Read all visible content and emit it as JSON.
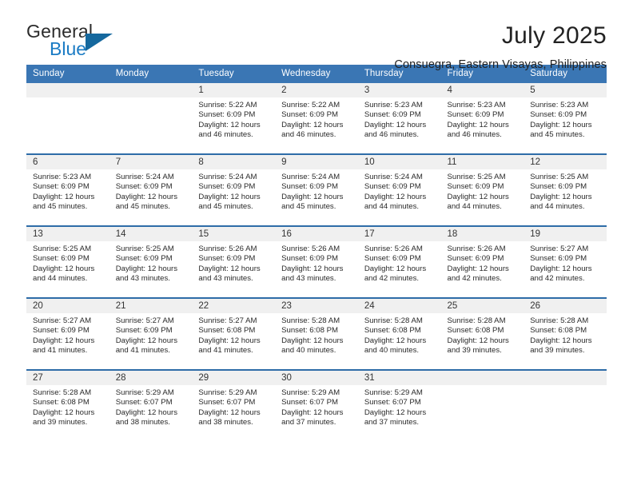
{
  "logo": {
    "text_top": "General",
    "text_bottom": "Blue",
    "triangle_color": "#15689e",
    "blue_color": "#1a7bc4"
  },
  "header": {
    "title": "July 2025",
    "subtitle": "Consuegra, Eastern Visayas, Philippines"
  },
  "theme": {
    "header_blue": "#3a76b4",
    "row_divider_blue": "#2e6ca8",
    "daynum_gray": "#f0f0f0"
  },
  "weekdays": [
    "Sunday",
    "Monday",
    "Tuesday",
    "Wednesday",
    "Thursday",
    "Friday",
    "Saturday"
  ],
  "labels": {
    "sunrise_prefix": "Sunrise:",
    "sunset_prefix": "Sunset:",
    "daylight_prefix": "Daylight:"
  },
  "weeks": [
    [
      {
        "day": "",
        "empty": true
      },
      {
        "day": "",
        "empty": true
      },
      {
        "day": "1",
        "sunrise": "Sunrise: 5:22 AM",
        "sunset": "Sunset: 6:09 PM",
        "daylight_line1": "Daylight: 12 hours",
        "daylight_line2": "and 46 minutes."
      },
      {
        "day": "2",
        "sunrise": "Sunrise: 5:22 AM",
        "sunset": "Sunset: 6:09 PM",
        "daylight_line1": "Daylight: 12 hours",
        "daylight_line2": "and 46 minutes."
      },
      {
        "day": "3",
        "sunrise": "Sunrise: 5:23 AM",
        "sunset": "Sunset: 6:09 PM",
        "daylight_line1": "Daylight: 12 hours",
        "daylight_line2": "and 46 minutes."
      },
      {
        "day": "4",
        "sunrise": "Sunrise: 5:23 AM",
        "sunset": "Sunset: 6:09 PM",
        "daylight_line1": "Daylight: 12 hours",
        "daylight_line2": "and 46 minutes."
      },
      {
        "day": "5",
        "sunrise": "Sunrise: 5:23 AM",
        "sunset": "Sunset: 6:09 PM",
        "daylight_line1": "Daylight: 12 hours",
        "daylight_line2": "and 45 minutes."
      }
    ],
    [
      {
        "day": "6",
        "sunrise": "Sunrise: 5:23 AM",
        "sunset": "Sunset: 6:09 PM",
        "daylight_line1": "Daylight: 12 hours",
        "daylight_line2": "and 45 minutes."
      },
      {
        "day": "7",
        "sunrise": "Sunrise: 5:24 AM",
        "sunset": "Sunset: 6:09 PM",
        "daylight_line1": "Daylight: 12 hours",
        "daylight_line2": "and 45 minutes."
      },
      {
        "day": "8",
        "sunrise": "Sunrise: 5:24 AM",
        "sunset": "Sunset: 6:09 PM",
        "daylight_line1": "Daylight: 12 hours",
        "daylight_line2": "and 45 minutes."
      },
      {
        "day": "9",
        "sunrise": "Sunrise: 5:24 AM",
        "sunset": "Sunset: 6:09 PM",
        "daylight_line1": "Daylight: 12 hours",
        "daylight_line2": "and 45 minutes."
      },
      {
        "day": "10",
        "sunrise": "Sunrise: 5:24 AM",
        "sunset": "Sunset: 6:09 PM",
        "daylight_line1": "Daylight: 12 hours",
        "daylight_line2": "and 44 minutes."
      },
      {
        "day": "11",
        "sunrise": "Sunrise: 5:25 AM",
        "sunset": "Sunset: 6:09 PM",
        "daylight_line1": "Daylight: 12 hours",
        "daylight_line2": "and 44 minutes."
      },
      {
        "day": "12",
        "sunrise": "Sunrise: 5:25 AM",
        "sunset": "Sunset: 6:09 PM",
        "daylight_line1": "Daylight: 12 hours",
        "daylight_line2": "and 44 minutes."
      }
    ],
    [
      {
        "day": "13",
        "sunrise": "Sunrise: 5:25 AM",
        "sunset": "Sunset: 6:09 PM",
        "daylight_line1": "Daylight: 12 hours",
        "daylight_line2": "and 44 minutes."
      },
      {
        "day": "14",
        "sunrise": "Sunrise: 5:25 AM",
        "sunset": "Sunset: 6:09 PM",
        "daylight_line1": "Daylight: 12 hours",
        "daylight_line2": "and 43 minutes."
      },
      {
        "day": "15",
        "sunrise": "Sunrise: 5:26 AM",
        "sunset": "Sunset: 6:09 PM",
        "daylight_line1": "Daylight: 12 hours",
        "daylight_line2": "and 43 minutes."
      },
      {
        "day": "16",
        "sunrise": "Sunrise: 5:26 AM",
        "sunset": "Sunset: 6:09 PM",
        "daylight_line1": "Daylight: 12 hours",
        "daylight_line2": "and 43 minutes."
      },
      {
        "day": "17",
        "sunrise": "Sunrise: 5:26 AM",
        "sunset": "Sunset: 6:09 PM",
        "daylight_line1": "Daylight: 12 hours",
        "daylight_line2": "and 42 minutes."
      },
      {
        "day": "18",
        "sunrise": "Sunrise: 5:26 AM",
        "sunset": "Sunset: 6:09 PM",
        "daylight_line1": "Daylight: 12 hours",
        "daylight_line2": "and 42 minutes."
      },
      {
        "day": "19",
        "sunrise": "Sunrise: 5:27 AM",
        "sunset": "Sunset: 6:09 PM",
        "daylight_line1": "Daylight: 12 hours",
        "daylight_line2": "and 42 minutes."
      }
    ],
    [
      {
        "day": "20",
        "sunrise": "Sunrise: 5:27 AM",
        "sunset": "Sunset: 6:09 PM",
        "daylight_line1": "Daylight: 12 hours",
        "daylight_line2": "and 41 minutes."
      },
      {
        "day": "21",
        "sunrise": "Sunrise: 5:27 AM",
        "sunset": "Sunset: 6:09 PM",
        "daylight_line1": "Daylight: 12 hours",
        "daylight_line2": "and 41 minutes."
      },
      {
        "day": "22",
        "sunrise": "Sunrise: 5:27 AM",
        "sunset": "Sunset: 6:08 PM",
        "daylight_line1": "Daylight: 12 hours",
        "daylight_line2": "and 41 minutes."
      },
      {
        "day": "23",
        "sunrise": "Sunrise: 5:28 AM",
        "sunset": "Sunset: 6:08 PM",
        "daylight_line1": "Daylight: 12 hours",
        "daylight_line2": "and 40 minutes."
      },
      {
        "day": "24",
        "sunrise": "Sunrise: 5:28 AM",
        "sunset": "Sunset: 6:08 PM",
        "daylight_line1": "Daylight: 12 hours",
        "daylight_line2": "and 40 minutes."
      },
      {
        "day": "25",
        "sunrise": "Sunrise: 5:28 AM",
        "sunset": "Sunset: 6:08 PM",
        "daylight_line1": "Daylight: 12 hours",
        "daylight_line2": "and 39 minutes."
      },
      {
        "day": "26",
        "sunrise": "Sunrise: 5:28 AM",
        "sunset": "Sunset: 6:08 PM",
        "daylight_line1": "Daylight: 12 hours",
        "daylight_line2": "and 39 minutes."
      }
    ],
    [
      {
        "day": "27",
        "sunrise": "Sunrise: 5:28 AM",
        "sunset": "Sunset: 6:08 PM",
        "daylight_line1": "Daylight: 12 hours",
        "daylight_line2": "and 39 minutes."
      },
      {
        "day": "28",
        "sunrise": "Sunrise: 5:29 AM",
        "sunset": "Sunset: 6:07 PM",
        "daylight_line1": "Daylight: 12 hours",
        "daylight_line2": "and 38 minutes."
      },
      {
        "day": "29",
        "sunrise": "Sunrise: 5:29 AM",
        "sunset": "Sunset: 6:07 PM",
        "daylight_line1": "Daylight: 12 hours",
        "daylight_line2": "and 38 minutes."
      },
      {
        "day": "30",
        "sunrise": "Sunrise: 5:29 AM",
        "sunset": "Sunset: 6:07 PM",
        "daylight_line1": "Daylight: 12 hours",
        "daylight_line2": "and 37 minutes."
      },
      {
        "day": "31",
        "sunrise": "Sunrise: 5:29 AM",
        "sunset": "Sunset: 6:07 PM",
        "daylight_line1": "Daylight: 12 hours",
        "daylight_line2": "and 37 minutes."
      },
      {
        "day": "",
        "empty": true
      },
      {
        "day": "",
        "empty": true
      }
    ]
  ]
}
